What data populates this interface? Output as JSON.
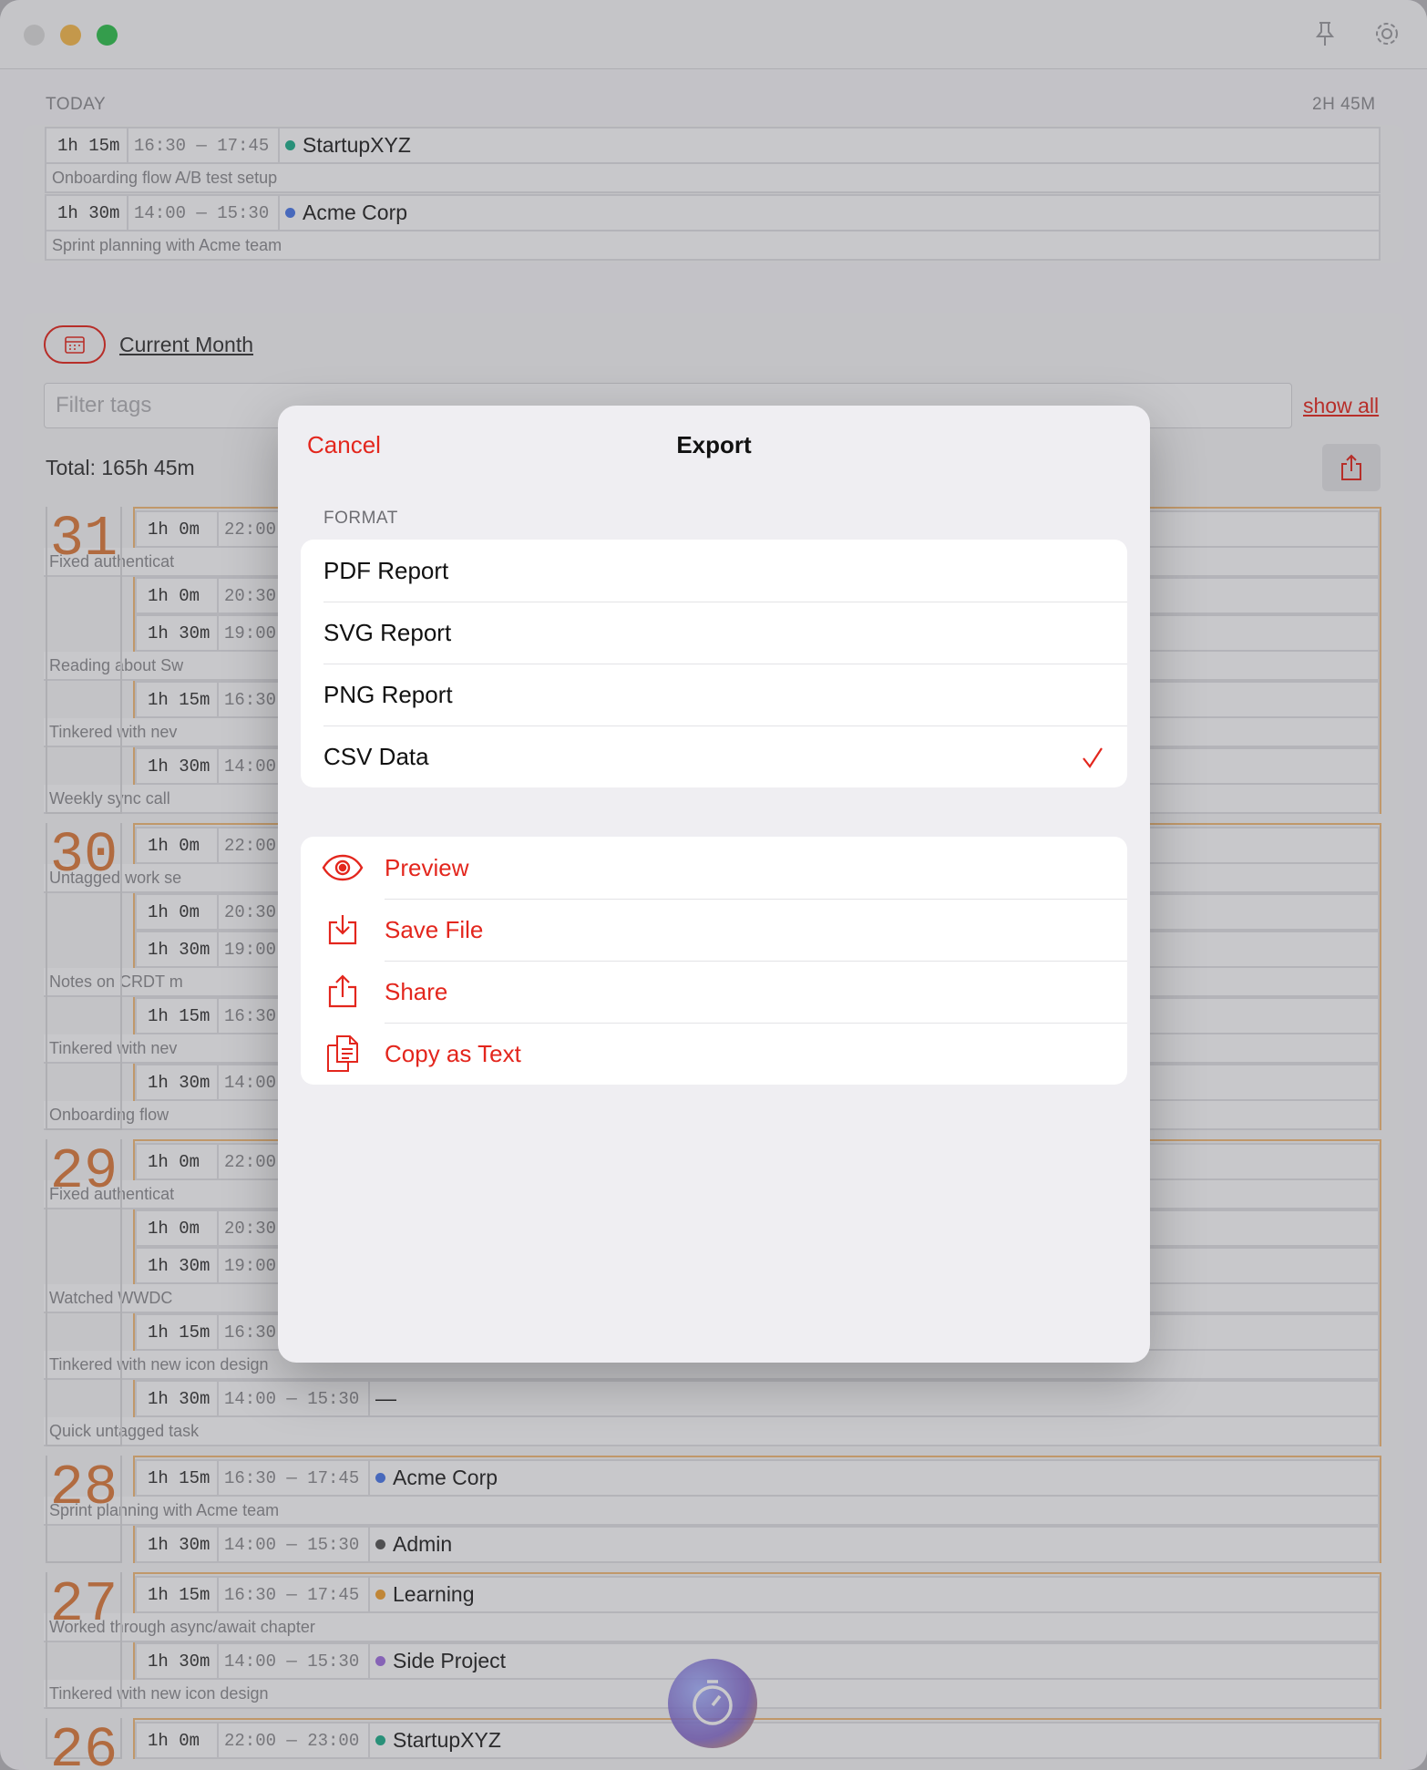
{
  "window": {
    "traffic_lights": [
      "#dadada",
      "#f6b94c",
      "#2fbf4d"
    ],
    "icons": [
      "pin-icon",
      "gear-icon"
    ]
  },
  "today": {
    "label": "TODAY",
    "total": "2H 45M",
    "entries": [
      {
        "duration": "1h 15m",
        "time": "16:30 — 17:45",
        "tag": "StartupXYZ",
        "color": "#1fae8b",
        "note": "Onboarding flow A/B test setup"
      },
      {
        "duration": "1h 30m",
        "time": "14:00 — 15:30",
        "tag": "Acme Corp",
        "color": "#4a78e8",
        "note": "Sprint planning with Acme team"
      }
    ]
  },
  "range": {
    "label": "Current Month",
    "icon": "calendar-icon"
  },
  "filter": {
    "placeholder": "Filter tags",
    "show_all": "show all"
  },
  "total": "Total: 165h 45m",
  "days": [
    {
      "day": "31",
      "rows": [
        {
          "duration": "1h 0m",
          "time": "22:00",
          "note": "Fixed authenticat"
        },
        {
          "duration": "1h 0m",
          "time": "20:30"
        },
        {
          "duration": "1h 30m",
          "time": "19:00",
          "note": "Reading about Sw"
        },
        {
          "duration": "1h 15m",
          "time": "16:30",
          "note": "Tinkered with nev"
        },
        {
          "duration": "1h 30m",
          "time": "14:00",
          "note": "Weekly sync call"
        }
      ]
    },
    {
      "day": "30",
      "rows": [
        {
          "duration": "1h 0m",
          "time": "22:00",
          "note": "Untagged work se"
        },
        {
          "duration": "1h 0m",
          "time": "20:30"
        },
        {
          "duration": "1h 30m",
          "time": "19:00",
          "note": "Notes on CRDT m"
        },
        {
          "duration": "1h 15m",
          "time": "16:30",
          "note": "Tinkered with nev"
        },
        {
          "duration": "1h 30m",
          "time": "14:00",
          "note": "Onboarding flow"
        }
      ]
    },
    {
      "day": "29",
      "rows": [
        {
          "duration": "1h 0m",
          "time": "22:00",
          "note": "Fixed authenticat"
        },
        {
          "duration": "1h 0m",
          "time": "20:30"
        },
        {
          "duration": "1h 30m",
          "time": "19:00",
          "note": "Watched WWDC"
        },
        {
          "duration": "1h 15m",
          "time": "16:30",
          "note": "Tinkered with new icon design"
        },
        {
          "duration": "1h 30m",
          "time": "14:00 — 15:30",
          "tag": "—",
          "note": "Quick untagged task"
        }
      ]
    },
    {
      "day": "28",
      "rows": [
        {
          "duration": "1h 15m",
          "time": "16:30 — 17:45",
          "tag": "Acme Corp",
          "color": "#4a78e8",
          "note": "Sprint planning with Acme team"
        },
        {
          "duration": "1h 30m",
          "time": "14:00 — 15:30",
          "tag": "Admin",
          "color": "#555555"
        }
      ]
    },
    {
      "day": "27",
      "rows": [
        {
          "duration": "1h 15m",
          "time": "16:30 — 17:45",
          "tag": "Learning",
          "color": "#f0a030",
          "note": "Worked through async/await chapter"
        },
        {
          "duration": "1h 30m",
          "time": "14:00 — 15:30",
          "tag": "Side Project",
          "color": "#a070e0",
          "note": "Tinkered with new icon design"
        }
      ]
    },
    {
      "day": "26",
      "rows": [
        {
          "duration": "1h 0m",
          "time": "22:00 — 23:00",
          "tag": "StartupXYZ",
          "color": "#1fae8b"
        }
      ]
    }
  ],
  "export": {
    "cancel": "Cancel",
    "title": "Export",
    "section": "FORMAT",
    "formats": [
      "PDF Report",
      "SVG Report",
      "PNG Report",
      "CSV Data"
    ],
    "selected": "CSV Data",
    "actions": [
      {
        "label": "Preview",
        "icon": "eye-icon"
      },
      {
        "label": "Save File",
        "icon": "save-file-icon"
      },
      {
        "label": "Share",
        "icon": "share-icon"
      },
      {
        "label": "Copy as Text",
        "icon": "copy-icon"
      }
    ],
    "accent": "#e3261d"
  }
}
